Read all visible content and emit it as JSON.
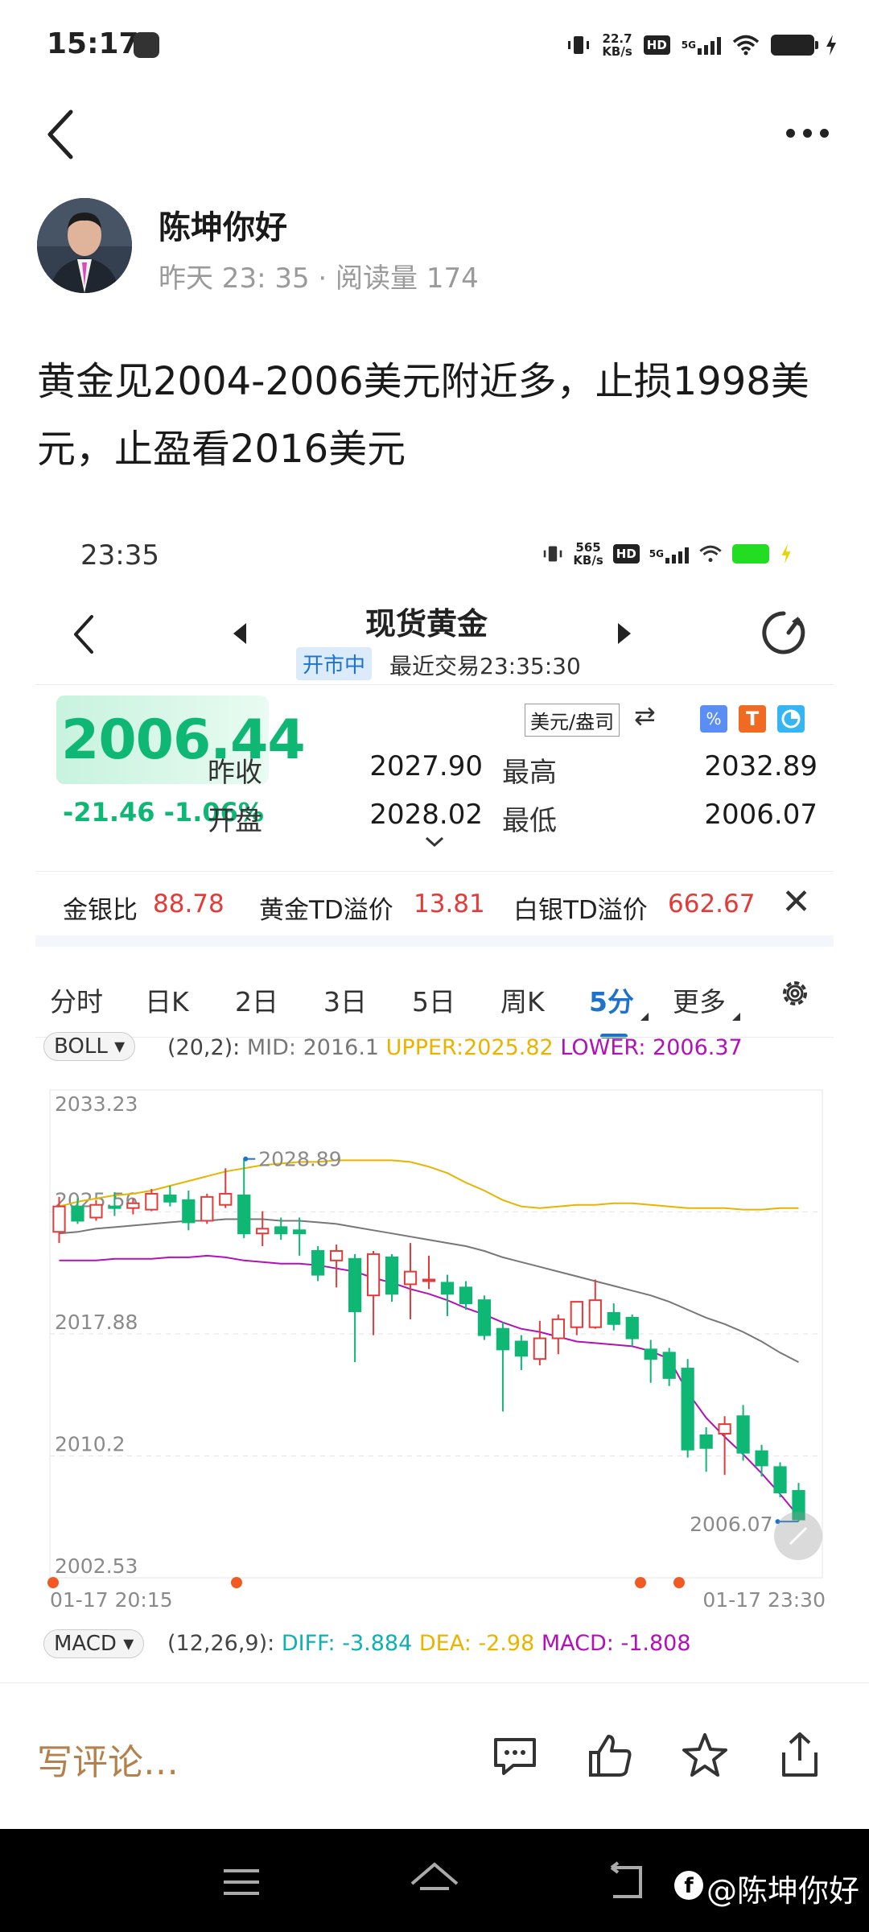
{
  "status_bar": {
    "time": "15:17",
    "net_speed_value": "22.7",
    "net_speed_unit": "KB/s",
    "hd": "HD",
    "network": "5G"
  },
  "nav": {
    "back_icon": "chevron-left-icon",
    "more_icon": "more-dots-icon"
  },
  "author": {
    "name": "陈坤你好",
    "meta": "昨天 23: 35 · 阅读量 174"
  },
  "post": {
    "text": "黄金见2004-2006美元附近多，止损1998美元，止盈看2016美元"
  },
  "embedded": {
    "status": {
      "time": "23:35",
      "net_speed_value": "565",
      "net_speed_unit": "KB/s",
      "hd": "HD",
      "network": "5G"
    },
    "title": "现货黄金",
    "market_status": "开市中",
    "last_trade": "最近交易23:35:30",
    "price": "2006.44",
    "change": "-21.46  -1.06%",
    "unit": "美元/盎司",
    "quote": {
      "prev_close_label": "昨收",
      "prev_close": "2027.90",
      "high_label": "最高",
      "high": "2032.89",
      "open_label": "开盘",
      "open": "2028.02",
      "low_label": "最低",
      "low": "2006.07"
    },
    "ratios": [
      {
        "label": "金银比",
        "value": "88.78"
      },
      {
        "label": "黄金TD溢价",
        "value": "13.81"
      },
      {
        "label": "白银TD溢价",
        "value": "662.67"
      }
    ],
    "tabs": [
      "分时",
      "日K",
      "2日",
      "3日",
      "5日",
      "周K",
      "5分",
      "更多"
    ],
    "active_tab": "5分",
    "boll": {
      "name": "BOLL",
      "params": "(20,2):",
      "mid": "MID: 2016.1",
      "upper": "UPPER:2025.82",
      "lower": "LOWER: 2006.37"
    },
    "macd": {
      "name": "MACD",
      "params": "(12,26,9):",
      "diff": "DIFF: -3.884",
      "dea": "DEA: -2.98",
      "macd": "MACD: -1.808"
    },
    "colors": {
      "up": "#e33a3a",
      "down": "#0fb775",
      "mid": "#777777",
      "upper": "#e8b400",
      "lower": "#b012b8",
      "accent": "#1e73c8"
    }
  },
  "chart_data": {
    "type": "candlestick",
    "y_ticks": [
      "2033.23",
      "2025.56",
      "2017.88",
      "2010.2",
      "2002.53"
    ],
    "ylim": [
      2002.53,
      2033.23
    ],
    "x_ticks": [
      "01-17 20:15",
      "01-17 23:30"
    ],
    "annotations": {
      "high": "2028.89",
      "low": "2006.07"
    },
    "candles": [
      {
        "o": 2024.3,
        "h": 2026.5,
        "c": 2025.9,
        "l": 2023.6
      },
      {
        "o": 2025.9,
        "h": 2026.4,
        "c": 2025.0,
        "l": 2024.8
      },
      {
        "o": 2025.2,
        "h": 2026.3,
        "c": 2026.0,
        "l": 2025.0
      },
      {
        "o": 2025.9,
        "h": 2026.8,
        "c": 2025.8,
        "l": 2025.3
      },
      {
        "o": 2025.8,
        "h": 2026.4,
        "c": 2026.1,
        "l": 2025.4
      },
      {
        "o": 2025.7,
        "h": 2027.0,
        "c": 2026.7,
        "l": 2025.6
      },
      {
        "o": 2026.6,
        "h": 2027.2,
        "c": 2026.2,
        "l": 2025.9
      },
      {
        "o": 2026.3,
        "h": 2026.9,
        "c": 2024.9,
        "l": 2024.4
      },
      {
        "o": 2025.0,
        "h": 2026.7,
        "c": 2026.5,
        "l": 2024.8
      },
      {
        "o": 2026.0,
        "h": 2028.3,
        "c": 2026.7,
        "l": 2025.8
      },
      {
        "o": 2026.6,
        "h": 2028.9,
        "c": 2024.2,
        "l": 2023.9
      },
      {
        "o": 2024.2,
        "h": 2025.6,
        "c": 2024.5,
        "l": 2023.4
      },
      {
        "o": 2024.6,
        "h": 2025.2,
        "c": 2024.2,
        "l": 2023.8
      },
      {
        "o": 2024.4,
        "h": 2025.2,
        "c": 2024.2,
        "l": 2022.8
      },
      {
        "o": 2023.1,
        "h": 2023.4,
        "c": 2021.6,
        "l": 2021.2
      },
      {
        "o": 2022.5,
        "h": 2023.5,
        "c": 2023.1,
        "l": 2020.8
      },
      {
        "o": 2022.6,
        "h": 2022.9,
        "c": 2019.3,
        "l": 2016.1
      },
      {
        "o": 2020.3,
        "h": 2023.1,
        "c": 2022.9,
        "l": 2017.8
      },
      {
        "o": 2022.7,
        "h": 2022.9,
        "c": 2020.4,
        "l": 2019.9
      },
      {
        "o": 2021.0,
        "h": 2023.6,
        "c": 2021.8,
        "l": 2018.8
      },
      {
        "o": 2021.2,
        "h": 2022.8,
        "c": 2021.3,
        "l": 2020.7
      },
      {
        "o": 2021.1,
        "h": 2021.6,
        "c": 2020.4,
        "l": 2019.0
      },
      {
        "o": 2020.8,
        "h": 2021.2,
        "c": 2019.8,
        "l": 2019.4
      },
      {
        "o": 2020.0,
        "h": 2020.3,
        "c": 2017.8,
        "l": 2017.5
      },
      {
        "o": 2018.2,
        "h": 2018.6,
        "c": 2016.9,
        "l": 2013.0
      },
      {
        "o": 2017.4,
        "h": 2017.8,
        "c": 2016.5,
        "l": 2015.6
      },
      {
        "o": 2016.3,
        "h": 2018.7,
        "c": 2017.6,
        "l": 2015.9
      },
      {
        "o": 2017.6,
        "h": 2019.1,
        "c": 2018.8,
        "l": 2016.6
      },
      {
        "o": 2018.3,
        "h": 2019.4,
        "c": 2019.9,
        "l": 2017.8
      },
      {
        "o": 2018.3,
        "h": 2021.3,
        "c": 2020.0,
        "l": 2018.2
      },
      {
        "o": 2019.2,
        "h": 2019.8,
        "c": 2018.5,
        "l": 2018.1
      },
      {
        "o": 2018.9,
        "h": 2019.1,
        "c": 2017.6,
        "l": 2017.1
      },
      {
        "o": 2016.9,
        "h": 2017.5,
        "c": 2016.3,
        "l": 2014.8
      },
      {
        "o": 2016.7,
        "h": 2017.0,
        "c": 2015.1,
        "l": 2014.6
      },
      {
        "o": 2015.7,
        "h": 2016.3,
        "c": 2010.6,
        "l": 2010.1
      },
      {
        "o": 2011.5,
        "h": 2012.0,
        "c": 2010.7,
        "l": 2009.2
      },
      {
        "o": 2011.6,
        "h": 2012.7,
        "c": 2012.2,
        "l": 2009.0
      },
      {
        "o": 2012.7,
        "h": 2013.4,
        "c": 2010.4,
        "l": 2009.9
      },
      {
        "o": 2010.5,
        "h": 2010.9,
        "c": 2009.6,
        "l": 2008.9
      },
      {
        "o": 2009.5,
        "h": 2009.8,
        "c": 2007.9,
        "l": 2007.6
      },
      {
        "o": 2008.0,
        "h": 2008.5,
        "c": 2006.2,
        "l": 2006.07
      }
    ],
    "series": [
      {
        "name": "MID",
        "values": [
          2024.2,
          2024.3,
          2024.5,
          2024.6,
          2024.7,
          2024.8,
          2024.9,
          2025.0,
          2025.0,
          2025.1,
          2025.1,
          2025.1,
          2025.0,
          2025.0,
          2024.9,
          2024.8,
          2024.6,
          2024.4,
          2024.2,
          2024.0,
          2023.8,
          2023.6,
          2023.4,
          2023.1,
          2022.7,
          2022.4,
          2022.1,
          2021.8,
          2021.5,
          2021.2,
          2020.9,
          2020.6,
          2020.3,
          2019.9,
          2019.4,
          2018.9,
          2018.5,
          2018.0,
          2017.4,
          2016.7,
          2016.1
        ]
      },
      {
        "name": "UPPER",
        "values": [
          2025.9,
          2026.2,
          2026.4,
          2026.6,
          2026.7,
          2026.9,
          2027.2,
          2027.5,
          2027.8,
          2028.1,
          2028.3,
          2028.5,
          2028.6,
          2028.7,
          2028.7,
          2028.8,
          2028.8,
          2028.8,
          2028.8,
          2028.7,
          2028.4,
          2028.0,
          2027.4,
          2026.9,
          2026.3,
          2025.9,
          2025.8,
          2025.9,
          2026.0,
          2026.0,
          2026.1,
          2026.1,
          2026.0,
          2025.9,
          2025.8,
          2025.8,
          2025.8,
          2025.7,
          2025.7,
          2025.8,
          2025.8
        ]
      },
      {
        "name": "LOWER",
        "values": [
          2022.5,
          2022.5,
          2022.5,
          2022.6,
          2022.6,
          2022.6,
          2022.7,
          2022.7,
          2022.8,
          2022.7,
          2022.5,
          2022.4,
          2022.3,
          2022.3,
          2022.2,
          2022.0,
          2021.8,
          2021.4,
          2021.1,
          2020.7,
          2020.4,
          2020.0,
          2019.5,
          2019.1,
          2018.6,
          2018.2,
          2018.0,
          2017.7,
          2017.4,
          2017.3,
          2017.2,
          2017.1,
          2016.8,
          2016.3,
          2014.2,
          2012.6,
          2011.4,
          2010.3,
          2009.1,
          2007.8,
          2006.4
        ]
      }
    ]
  },
  "comment_bar": {
    "placeholder": "写评论…",
    "icons": [
      "comment-icon",
      "like-icon",
      "star-icon",
      "share-icon"
    ]
  },
  "watermark": {
    "text": "@陈坤你好"
  }
}
